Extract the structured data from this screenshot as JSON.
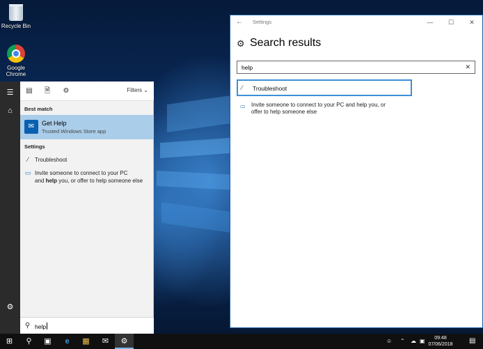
{
  "desktop": {
    "icons": [
      {
        "label": "Recycle Bin",
        "icon": "recycle-bin-icon"
      },
      {
        "label": "Google Chrome",
        "icon": "chrome-icon"
      }
    ]
  },
  "start_menu": {
    "rail": {
      "menu_icon": "hamburger-icon",
      "home_icon": "home-icon",
      "settings_icon": "gear-icon"
    },
    "top_bar": {
      "icons": [
        "apps-icon",
        "documents-icon",
        "settings-gear-icon"
      ],
      "filters_label": "Filters"
    },
    "best_match_heading": "Best match",
    "best_match": {
      "title": "Get Help",
      "subtitle": "Trusted Windows Store app",
      "icon": "get-help-icon"
    },
    "settings_heading": "Settings",
    "results": [
      {
        "label": "Troubleshoot",
        "icon": "wrench-icon"
      },
      {
        "line1": "Invite someone to connect to your PC",
        "line2_pre": "and",
        "line2_bold": "help",
        "line2_post": "you, or offer to help someone else",
        "icon": "monitor-icon"
      }
    ],
    "search": {
      "value": "help"
    }
  },
  "settings_window": {
    "title": "Settings",
    "heading": "Search results",
    "search_value": "help",
    "results": [
      {
        "label": "Troubleshoot",
        "icon": "wrench-icon",
        "selected": true
      },
      {
        "line1": "Invite someone to connect to your PC and help you, or",
        "line2": "offer to help someone else",
        "icon": "monitor-icon"
      }
    ]
  },
  "taskbar": {
    "clock_time": "09:48",
    "clock_date": "07/06/2018",
    "apps": [
      "windows-start-icon",
      "search-icon",
      "task-view-icon",
      "edge-icon",
      "file-explorer-icon",
      "mail-icon",
      "settings-icon"
    ]
  }
}
